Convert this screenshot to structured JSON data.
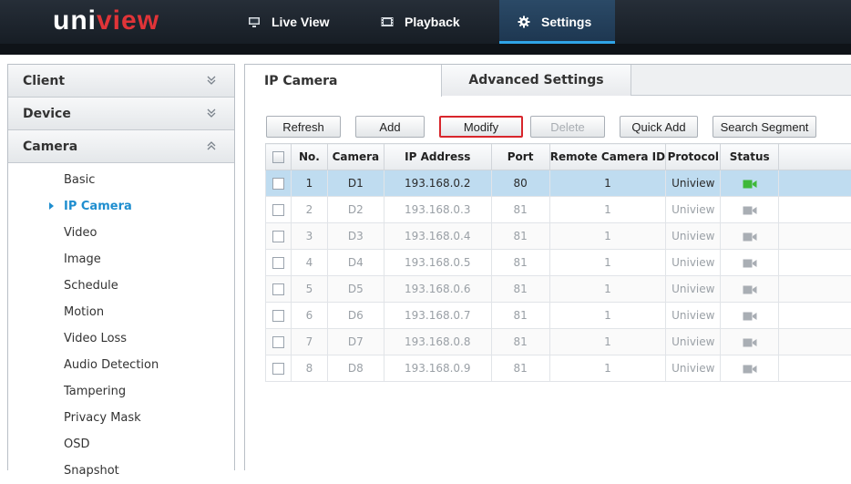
{
  "brand": {
    "logo_part1": "uni",
    "logo_part2": "view"
  },
  "nav": {
    "live_view": "Live View",
    "playback": "Playback",
    "settings": "Settings"
  },
  "sidebar": {
    "sections": [
      {
        "label": "Client",
        "state": "collapsed"
      },
      {
        "label": "Device",
        "state": "collapsed"
      },
      {
        "label": "Camera",
        "state": "expanded"
      }
    ],
    "camera_items": [
      {
        "label": "Basic"
      },
      {
        "label": "IP Camera",
        "active": true
      },
      {
        "label": "Video"
      },
      {
        "label": "Image"
      },
      {
        "label": "Schedule"
      },
      {
        "label": "Motion"
      },
      {
        "label": "Video Loss"
      },
      {
        "label": "Audio Detection"
      },
      {
        "label": "Tampering"
      },
      {
        "label": "Privacy Mask"
      },
      {
        "label": "OSD"
      },
      {
        "label": "Snapshot"
      }
    ]
  },
  "tabs": {
    "ip_camera": "IP Camera",
    "advanced_settings": "Advanced Settings"
  },
  "toolbar": {
    "refresh": "Refresh",
    "add": "Add",
    "modify": "Modify",
    "delete": "Delete",
    "quick_add": "Quick Add",
    "search_segment": "Search Segment"
  },
  "table": {
    "headers": [
      "No.",
      "Camera",
      "IP Address",
      "Port",
      "Remote Camera ID",
      "Protocol",
      "Status"
    ],
    "rows": [
      {
        "no": "1",
        "camera": "D1",
        "ip": "193.168.0.2",
        "port": "80",
        "remote_id": "1",
        "protocol": "Uniview",
        "status": "online"
      },
      {
        "no": "2",
        "camera": "D2",
        "ip": "193.168.0.3",
        "port": "81",
        "remote_id": "1",
        "protocol": "Uniview",
        "status": "offline"
      },
      {
        "no": "3",
        "camera": "D3",
        "ip": "193.168.0.4",
        "port": "81",
        "remote_id": "1",
        "protocol": "Uniview",
        "status": "offline"
      },
      {
        "no": "4",
        "camera": "D4",
        "ip": "193.168.0.5",
        "port": "81",
        "remote_id": "1",
        "protocol": "Uniview",
        "status": "offline"
      },
      {
        "no": "5",
        "camera": "D5",
        "ip": "193.168.0.6",
        "port": "81",
        "remote_id": "1",
        "protocol": "Uniview",
        "status": "offline"
      },
      {
        "no": "6",
        "camera": "D6",
        "ip": "193.168.0.7",
        "port": "81",
        "remote_id": "1",
        "protocol": "Uniview",
        "status": "offline"
      },
      {
        "no": "7",
        "camera": "D7",
        "ip": "193.168.0.8",
        "port": "81",
        "remote_id": "1",
        "protocol": "Uniview",
        "status": "offline"
      },
      {
        "no": "8",
        "camera": "D8",
        "ip": "193.168.0.9",
        "port": "81",
        "remote_id": "1",
        "protocol": "Uniview",
        "status": "offline"
      }
    ]
  },
  "colors": {
    "accent": "#1f8ecf",
    "online": "#3fb83a",
    "offline": "#a9aeb4",
    "selected_row": "#bfdcf0",
    "highlight_border": "#d8262c",
    "brand_red": "#e03438"
  }
}
